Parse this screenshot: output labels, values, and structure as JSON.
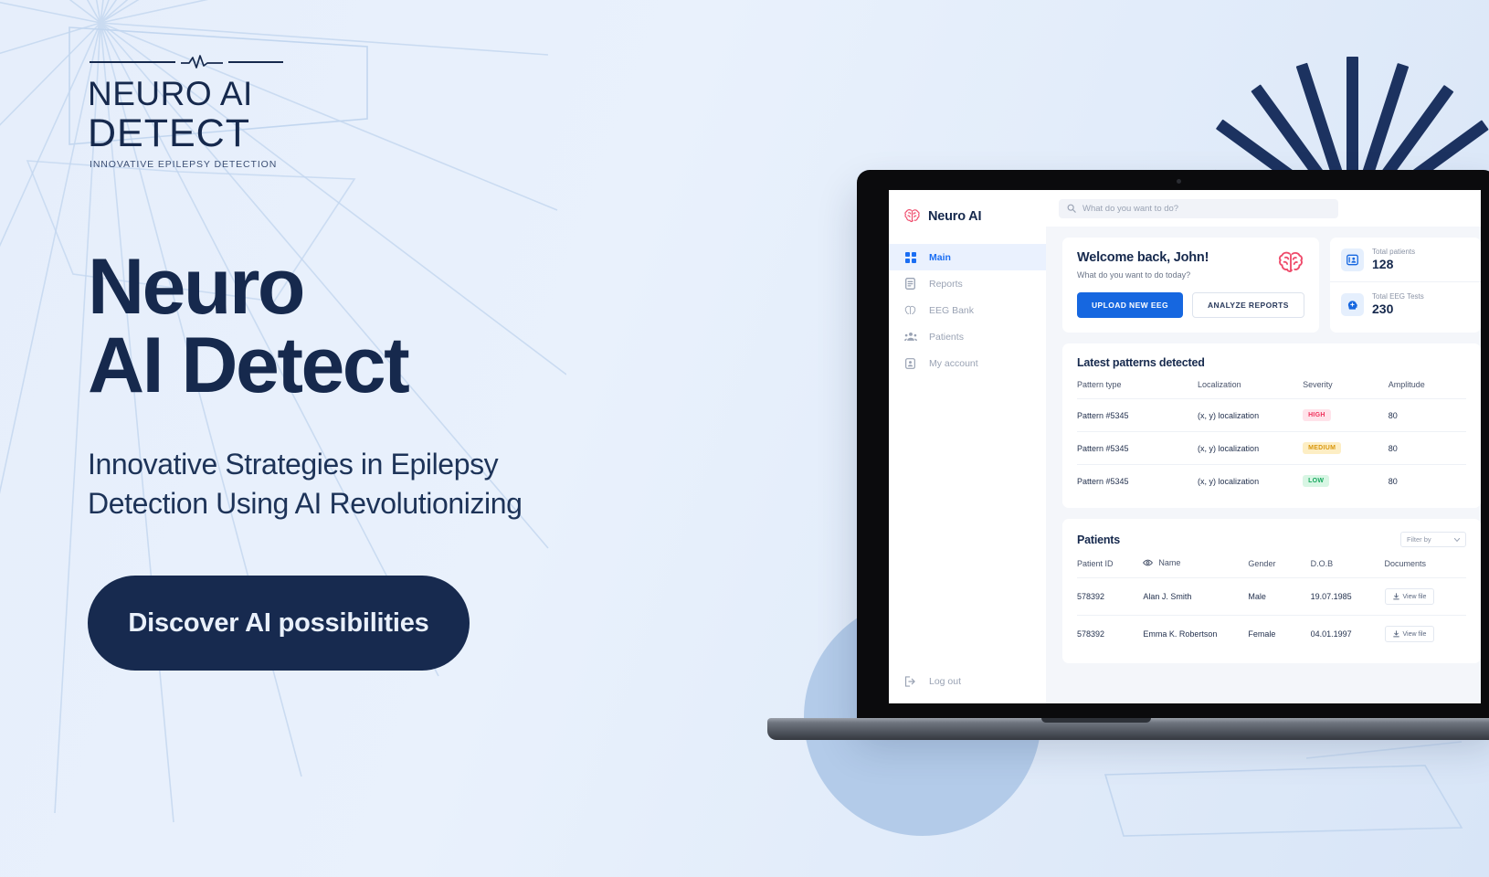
{
  "brand_logo": {
    "name_line1": "NEURO AI",
    "name_line2": "DETECT",
    "tagline": "INNOVATIVE EPILEPSY DETECTION"
  },
  "hero": {
    "headline_line1": "Neuro",
    "headline_line2": "AI Detect",
    "subhead_line1": "Innovative Strategies in Epilepsy",
    "subhead_line2": "Detection Using AI Revolutionizing",
    "cta_label": "Discover AI possibilities"
  },
  "colors": {
    "navy": "#16294d",
    "page_bg": "#e8f0fb",
    "accent_blue": "#1667e0",
    "sidebar_active_bg": "#eaf1fe",
    "brain_red": "#ef4b6b",
    "high": "#f0325c",
    "medium": "#d9970d",
    "low": "#16a85e",
    "circle_blue": "#b3cbe9"
  },
  "dashboard": {
    "brand": {
      "label": "Neuro AI",
      "icon": "brain-icon"
    },
    "search": {
      "placeholder": "What do you want to do?",
      "icon": "search-icon"
    },
    "sidebar": {
      "items": [
        {
          "label": "Main",
          "icon": "grid-icon",
          "active": true
        },
        {
          "label": "Reports",
          "icon": "document-icon",
          "active": false
        },
        {
          "label": "EEG Bank",
          "icon": "brain-icon",
          "active": false
        },
        {
          "label": "Patients",
          "icon": "people-icon",
          "active": false
        },
        {
          "label": "My account",
          "icon": "account-icon",
          "active": false
        }
      ],
      "logout": {
        "label": "Log out",
        "icon": "logout-icon"
      }
    },
    "welcome": {
      "title": "Welcome back, John!",
      "subtitle": "What do you want to do today?",
      "primary_button": "UPLOAD NEW EEG",
      "secondary_button": "ANALYZE REPORTS"
    },
    "stats": [
      {
        "label": "Total patients",
        "value": "128",
        "icon": "patient-card-icon"
      },
      {
        "label": "Total EEG Tests",
        "value": "230",
        "icon": "head-scan-icon"
      }
    ],
    "patterns": {
      "title": "Latest patterns detected",
      "columns": [
        "Pattern type",
        "Localization",
        "Severity",
        "Amplitude"
      ],
      "rows": [
        {
          "type": "Pattern #5345",
          "localization": "(x, y) localization",
          "severity": "HIGH",
          "severity_level": "high",
          "amplitude": "80"
        },
        {
          "type": "Pattern #5345",
          "localization": "(x, y) localization",
          "severity": "MEDIUM",
          "severity_level": "medium",
          "amplitude": "80"
        },
        {
          "type": "Pattern #5345",
          "localization": "(x, y) localization",
          "severity": "LOW",
          "severity_level": "low",
          "amplitude": "80"
        }
      ]
    },
    "patients": {
      "title": "Patients",
      "filter_label": "Filter by",
      "columns": [
        "Patient ID",
        "Name",
        "Gender",
        "D.O.B",
        "Documents"
      ],
      "rows": [
        {
          "id": "578392",
          "name": "Alan J. Smith",
          "gender": "Male",
          "dob": "19.07.1985",
          "document_label": "View file"
        },
        {
          "id": "578392",
          "name": "Emma K. Robertson",
          "gender": "Female",
          "dob": "04.01.1997",
          "document_label": "View file"
        }
      ]
    }
  }
}
